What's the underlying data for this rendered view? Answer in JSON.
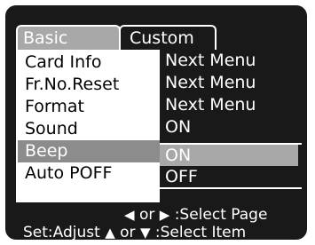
{
  "tabs": {
    "basic": "Basic",
    "custom": "Custom"
  },
  "menu": {
    "items": [
      {
        "label": "Card Info",
        "value": "Next Menu"
      },
      {
        "label": "Fr.No.Reset",
        "value": "Next Menu"
      },
      {
        "label": "Format",
        "value": "Next Menu"
      },
      {
        "label": "Sound",
        "value": "ON"
      },
      {
        "label": "Beep",
        "value": ""
      },
      {
        "label": "Auto POFF",
        "value": ""
      }
    ],
    "selected_item": "Beep",
    "options": [
      "ON",
      "OFF"
    ],
    "highlighted_option": "ON"
  },
  "footer": {
    "page_hint_or": "or",
    "page_hint_text": ":Select Page",
    "set_label": "Set:Adjust",
    "item_hint_or": "or",
    "item_hint_text": ":Select Item",
    "icons": {
      "left": "left-arrow-icon",
      "right": "right-arrow-icon",
      "up": "up-arrow-icon",
      "down": "down-arrow-icon"
    }
  },
  "colors": {
    "lcd_background": "#191919",
    "selection": "#8c8c8c",
    "tab_active": "#a8a8a8"
  }
}
